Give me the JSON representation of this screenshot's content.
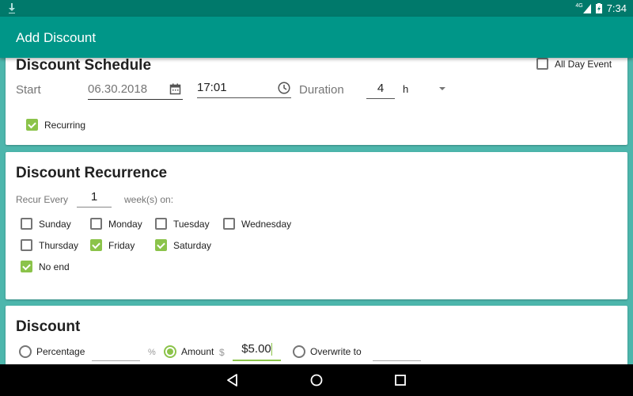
{
  "status": {
    "network": "4G",
    "time": "7:34"
  },
  "appbar": {
    "title": "Add Discount"
  },
  "schedule": {
    "title": "Discount Schedule",
    "all_day_label": "All Day Event",
    "all_day_checked": false,
    "start_label": "Start",
    "date": "06.30.2018",
    "time": "17:01",
    "duration_label": "Duration",
    "duration": "4",
    "duration_unit": "h",
    "recurring_label": "Recurring",
    "recurring_checked": true
  },
  "recurrence": {
    "title": "Discount Recurrence",
    "recur_every_label": "Recur Every",
    "interval": "1",
    "unit_label": "week(s) on:",
    "days": [
      {
        "label": "Sunday",
        "checked": false
      },
      {
        "label": "Monday",
        "checked": false
      },
      {
        "label": "Tuesday",
        "checked": false
      },
      {
        "label": "Wednesday",
        "checked": false
      },
      {
        "label": "Thursday",
        "checked": false
      },
      {
        "label": "Friday",
        "checked": true
      },
      {
        "label": "Saturday",
        "checked": true
      }
    ],
    "no_end_label": "No end",
    "no_end_checked": true
  },
  "discount": {
    "title": "Discount",
    "percentage_label": "Percentage",
    "percentage_value": "",
    "percent_sign": "%",
    "amount_label": "Amount",
    "dollar_sign": "$",
    "amount_value": "$5.00",
    "overwrite_label": "Overwrite to",
    "overwrite_value": "",
    "selected": "amount"
  }
}
